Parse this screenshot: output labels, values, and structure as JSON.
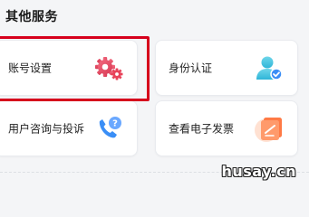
{
  "section": {
    "title": "其他服务"
  },
  "cards": [
    {
      "label": "账号设置",
      "icon": "gear-icon"
    },
    {
      "label": "身份认证",
      "icon": "user-verified-icon"
    },
    {
      "label": "用户咨询与投诉",
      "icon": "phone-help-icon"
    },
    {
      "label": "查看电子发票",
      "icon": "invoice-icon"
    }
  ],
  "watermark": "husay.cn",
  "colors": {
    "accent_red": "#e8435a",
    "highlight_red": "#d6001c",
    "icon_blue": "#3a8ef6",
    "icon_cyan": "#4cc9e8",
    "icon_orange": "#ff7a45"
  }
}
